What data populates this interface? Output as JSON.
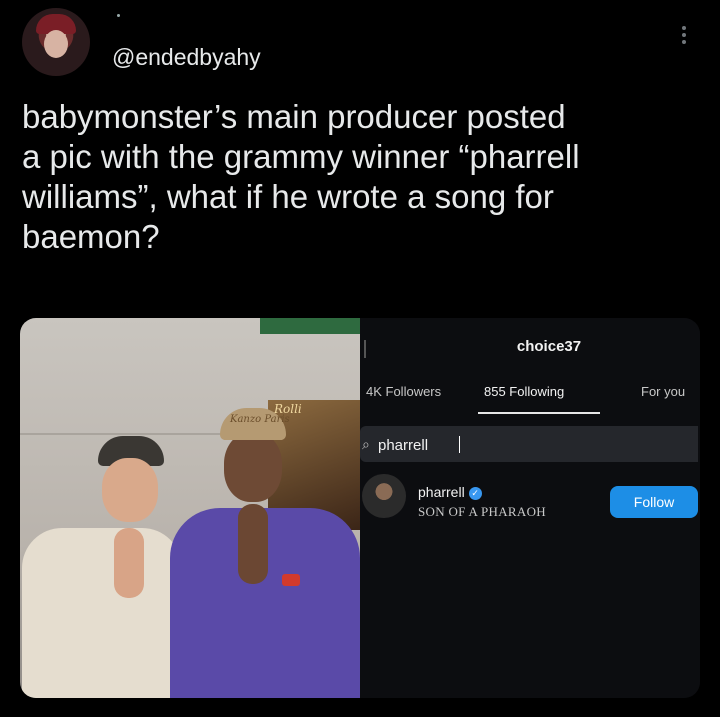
{
  "tweet": {
    "handle": "@endedbyahy",
    "text": "babymonster’s main producer posted\na pic with the grammy winner “pharrell\nwilliams”, what if he wrote a song for\nbaemon?"
  },
  "photo": {
    "poster_text": "Rolli",
    "cap_text": "Kanzo Paris"
  },
  "instagram": {
    "username": "choice37",
    "tabs": [
      {
        "label": "4K Followers"
      },
      {
        "label": "855 Following"
      },
      {
        "label": "For you"
      }
    ],
    "search": {
      "value": "pharrell"
    },
    "result": {
      "name": "pharrell",
      "subtitle": "SON OF A PHARAOH",
      "follow_label": "Follow"
    }
  },
  "colors": {
    "background": "#000000",
    "text": "#e7e9ea",
    "follow_button": "#1d8ee6",
    "verified": "#3897f0"
  }
}
